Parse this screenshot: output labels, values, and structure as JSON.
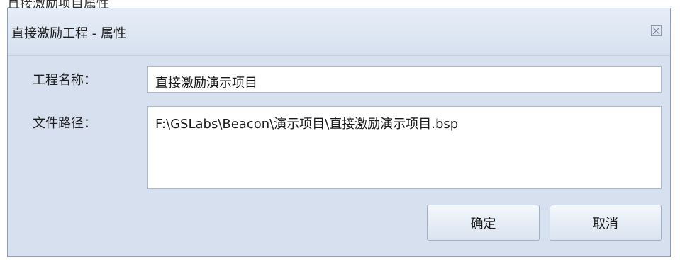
{
  "window_caption": "直接激励项目属性",
  "dialog": {
    "title": "直接激励工程 - 属性",
    "close_icon": "close-icon"
  },
  "form": {
    "project_name_label": "工程名称：",
    "project_name_value": "直接激励演示项目",
    "file_path_label": "文件路径：",
    "file_path_value": "F:\\GSLabs\\Beacon\\演示项目\\直接激励演示项目.bsp"
  },
  "buttons": {
    "ok_label": "确定",
    "cancel_label": "取消"
  },
  "colors": {
    "dialog_background": "#d6e0ef",
    "border": "#8ba0bc",
    "input_background": "#ffffff"
  }
}
